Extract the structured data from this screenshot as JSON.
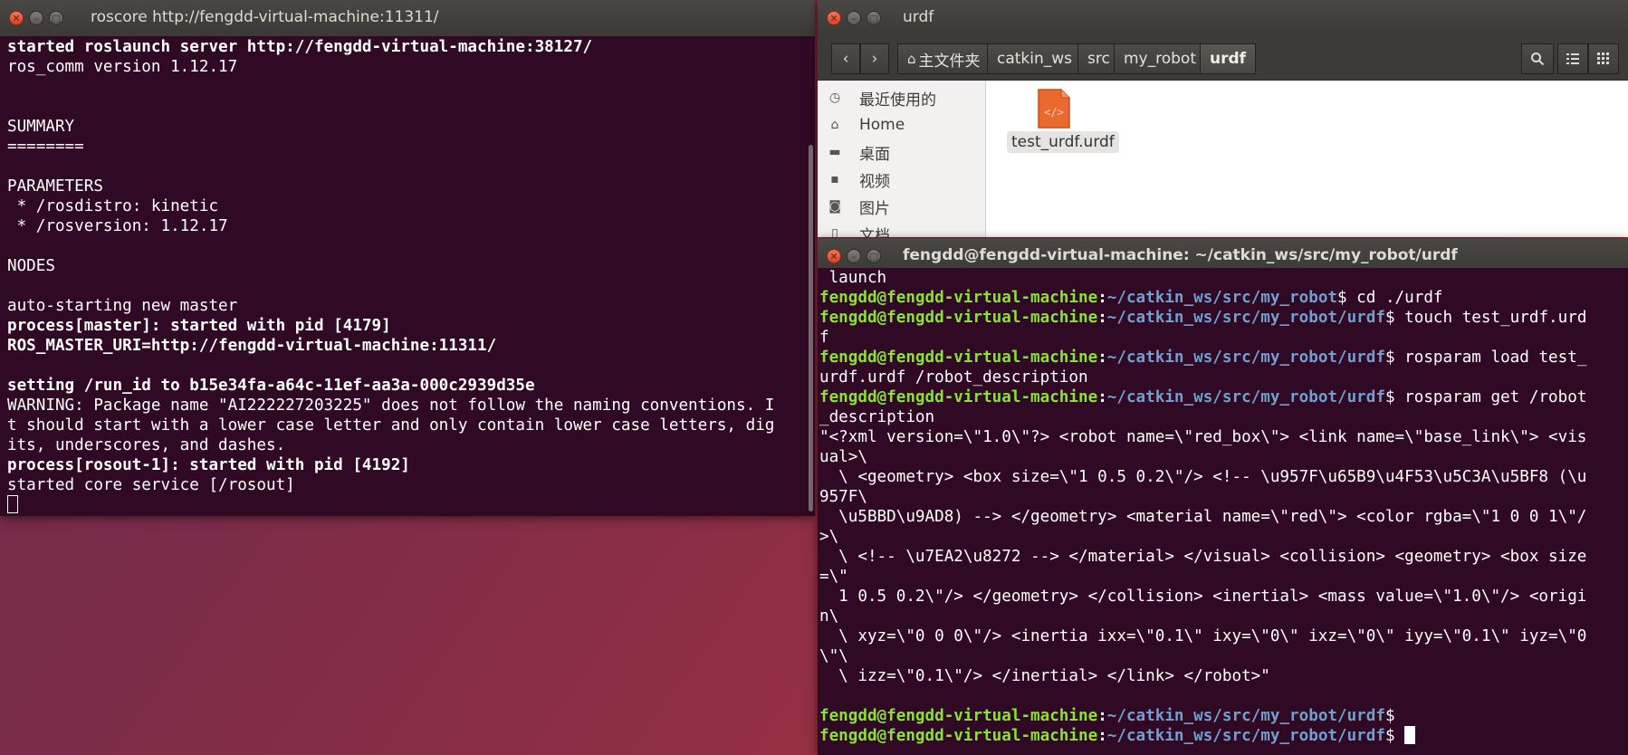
{
  "roscore_window": {
    "title": "roscore http://fengdd-virtual-machine:11311/",
    "lines": [
      {
        "text": "started roslaunch server http://fengdd-virtual-machine:38127/",
        "bold": true
      },
      {
        "text": "ros_comm version 1.12.17",
        "bold": false
      },
      {
        "text": "",
        "bold": false
      },
      {
        "text": "",
        "bold": false
      },
      {
        "text": "SUMMARY",
        "bold": false
      },
      {
        "text": "========",
        "bold": false
      },
      {
        "text": "",
        "bold": false
      },
      {
        "text": "PARAMETERS",
        "bold": false
      },
      {
        "text": " * /rosdistro: kinetic",
        "bold": false
      },
      {
        "text": " * /rosversion: 1.12.17",
        "bold": false
      },
      {
        "text": "",
        "bold": false
      },
      {
        "text": "NODES",
        "bold": false
      },
      {
        "text": "",
        "bold": false
      },
      {
        "text": "auto-starting new master",
        "bold": false
      },
      {
        "text": "process[master]: started with pid [4179]",
        "bold": true
      },
      {
        "text": "ROS_MASTER_URI=http://fengdd-virtual-machine:11311/",
        "bold": true
      },
      {
        "text": "",
        "bold": false
      },
      {
        "text": "setting /run_id to b15e34fa-a64c-11ef-aa3a-000c2939d35e",
        "bold": true
      },
      {
        "text": "WARNING: Package name \"AI222227203225\" does not follow the naming conventions. I",
        "bold": false
      },
      {
        "text": "t should start with a lower case letter and only contain lower case letters, dig",
        "bold": false
      },
      {
        "text": "its, underscores, and dashes.",
        "bold": false
      },
      {
        "text": "process[rosout-1]: started with pid [4192]",
        "bold": true
      },
      {
        "text": "started core service [/rosout]",
        "bold": false
      }
    ]
  },
  "file_manager": {
    "title": "urdf",
    "breadcrumbs": [
      {
        "label": "主文件夹",
        "icon": "home-icon"
      },
      {
        "label": "catkin_ws"
      },
      {
        "label": "src"
      },
      {
        "label": "my_robot"
      },
      {
        "label": "urdf"
      }
    ],
    "sidebar": [
      {
        "label": "最近使用的",
        "icon": "clock-icon"
      },
      {
        "label": "Home",
        "icon": "home-icon"
      },
      {
        "label": "桌面",
        "icon": "folder-icon"
      },
      {
        "label": "视频",
        "icon": "video-icon"
      },
      {
        "label": "图片",
        "icon": "camera-icon"
      },
      {
        "label": "文档",
        "icon": "document-icon"
      }
    ],
    "files": [
      {
        "name": "test_urdf.urdf",
        "icon": "code-file-icon"
      }
    ],
    "accent_color": "#e95420"
  },
  "terminal2": {
    "title": "fengdd@fengdd-virtual-machine: ~/catkin_ws/src/my_robot/urdf",
    "lines": [
      {
        "plain": " launch"
      },
      {
        "user": "fengdd@fengdd-virtual-machine",
        "path": "~/catkin_ws/src/my_robot",
        "cmd": "$ cd ./urdf"
      },
      {
        "user": "fengdd@fengdd-virtual-machine",
        "path": "~/catkin_ws/src/my_robot/urdf",
        "cmd": "$ touch test_urdf.urd"
      },
      {
        "plain": "f"
      },
      {
        "user": "fengdd@fengdd-virtual-machine",
        "path": "~/catkin_ws/src/my_robot/urdf",
        "cmd": "$ rosparam load test_"
      },
      {
        "plain": "urdf.urdf /robot_description"
      },
      {
        "user": "fengdd@fengdd-virtual-machine",
        "path": "~/catkin_ws/src/my_robot/urdf",
        "cmd": "$ rosparam get /robot"
      },
      {
        "plain": "_description"
      },
      {
        "plain": "\"<?xml version=\\\"1.0\\\"?> <robot name=\\\"red_box\\\"> <link name=\\\"base_link\\\"> <vis"
      },
      {
        "plain": "ual>\\"
      },
      {
        "plain": "  \\ <geometry> <box size=\\\"1 0.5 0.2\\\"/> <!-- \\u957F\\u65B9\\u4F53\\u5C3A\\u5BF8 (\\u"
      },
      {
        "plain": "957F\\"
      },
      {
        "plain": "  \\u5BBD\\u9AD8) --> </geometry> <material name=\\\"red\\\"> <color rgba=\\\"1 0 0 1\\\"/"
      },
      {
        "plain": ">\\"
      },
      {
        "plain": "  \\ <!-- \\u7EA2\\u8272 --> </material> </visual> <collision> <geometry> <box size"
      },
      {
        "plain": "=\\\""
      },
      {
        "plain": "  1 0.5 0.2\\\"/> </geometry> </collision> <inertial> <mass value=\\\"1.0\\\"/> <origi"
      },
      {
        "plain": "n\\"
      },
      {
        "plain": "  \\ xyz=\\\"0 0 0\\\"/> <inertia ixx=\\\"0.1\\\" ixy=\\\"0\\\" ixz=\\\"0\\\" iyy=\\\"0.1\\\" iyz=\\\"0"
      },
      {
        "plain": "\\\"\\"
      },
      {
        "plain": "  \\ izz=\\\"0.1\\\"/> </inertial> </link> </robot>\""
      },
      {
        "plain": ""
      },
      {
        "user": "fengdd@fengdd-virtual-machine",
        "path": "~/catkin_ws/src/my_robot/urdf",
        "cmd": "$"
      },
      {
        "user": "fengdd@fengdd-virtual-machine",
        "path": "~/catkin_ws/src/my_robot/urdf",
        "cmd": "$"
      }
    ]
  },
  "colors": {
    "terminal_bg": "#300a24",
    "prompt_user": "#8ae234",
    "prompt_path": "#729fcf"
  }
}
